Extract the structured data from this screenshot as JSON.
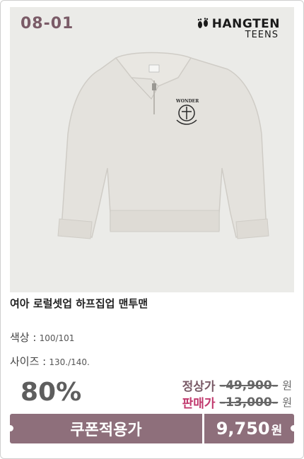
{
  "product": {
    "code": "08-01",
    "brand_name": "HANGTEN",
    "brand_sub": "TEENS",
    "brand_icon": "footprints-icon",
    "print_text": "WONDER",
    "title": "여아 로럴셋업 하프집업 맨투맨",
    "color_label": "색상 :",
    "color_value": "100/101",
    "size_label": "사이즈 :",
    "size_value": "130./140.",
    "discount": "80%",
    "regular_label": "정상가",
    "regular_price": "49,900",
    "sale_label": "판매가",
    "sale_price": "13,000",
    "won": "원",
    "coupon_label": "쿠폰적용가",
    "coupon_price": "9,750",
    "coupon_won": "원"
  },
  "colors": {
    "accent": "#8e6f7b",
    "regular_label": "#7a5b67",
    "sale_label": "#c13a6e",
    "photo_bg": "#ebebe8"
  }
}
